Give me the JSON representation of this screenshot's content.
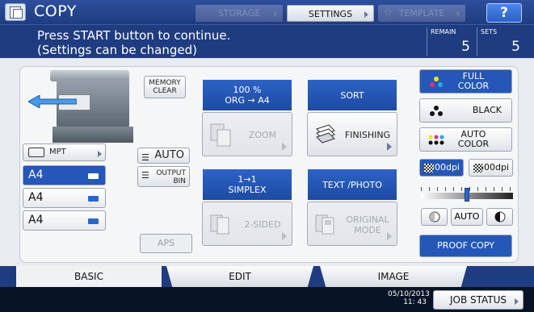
{
  "header": {
    "title": "COPY",
    "storage_label": "STORAGE",
    "settings_label": "SETTINGS",
    "template_label": "TEMPLATE",
    "help_label": "?"
  },
  "message": {
    "line1": "Press START button to continue.",
    "line2": "(Settings can be changed)",
    "remain_label": "REMAIN",
    "remain_value": "5",
    "sets_label": "SETS",
    "sets_value": "5"
  },
  "paper": {
    "mpt_label": "MPT",
    "trays": [
      "A4",
      "A4",
      "A4"
    ],
    "selected_tray": 0,
    "memory_clear": "MEMORY\nCLEAR",
    "auto_label": "AUTO",
    "output_bin": "OUTPUT\nBIN",
    "aps_label": "APS"
  },
  "functions": {
    "ratio_line1": "100 %",
    "ratio_line2": "ORG  →  A4",
    "zoom_label": "ZOOM",
    "sort_label": "SORT",
    "finishing_label": "FINISHING",
    "duplex_line1": "1→1",
    "duplex_line2": "SIMPLEX",
    "twosided_label": "2-SIDED",
    "text_photo_label": "TEXT /PHOTO",
    "original_mode_label": "ORIGINAL\nMODE"
  },
  "color": {
    "full_color": "FULL\nCOLOR",
    "black": "BLACK",
    "auto_color": "AUTO\nCOLOR",
    "selected": "full_color"
  },
  "resolution": {
    "options": [
      "300dpi",
      "600dpi"
    ],
    "selected": "300dpi"
  },
  "density": {
    "level": 0.5,
    "auto_label": "AUTO"
  },
  "proof_copy_label": "PROOF COPY",
  "tabs": {
    "basic": "BASIC",
    "edit": "EDIT",
    "image": "IMAGE",
    "active": "basic"
  },
  "status": {
    "date": "05/10/2013",
    "time": "11: 43",
    "job_status_label": "JOB STATUS"
  },
  "colors": {
    "accent_blue": "#2557b8",
    "header_blue": "#1f3c80",
    "tab_active_marker": "#f0a020"
  }
}
